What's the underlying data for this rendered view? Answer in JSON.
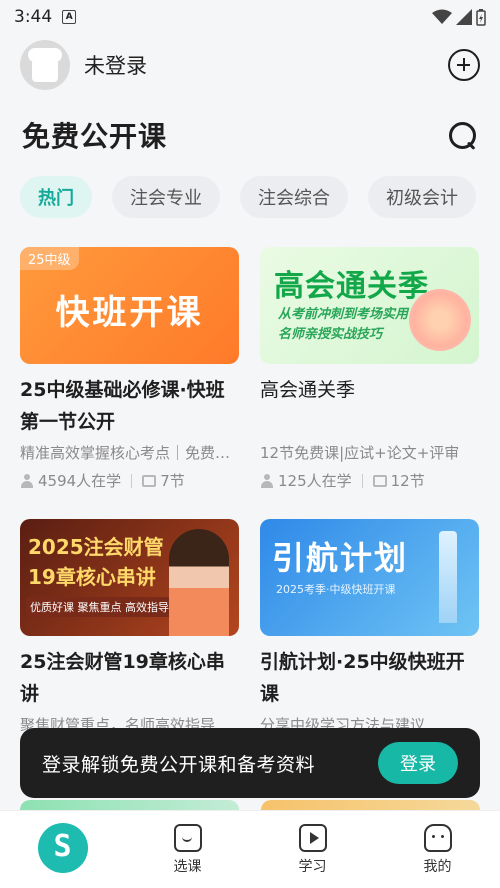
{
  "status_bar": {
    "time": "3:44",
    "notification_glyph": "A"
  },
  "user": {
    "login_label": "未登录"
  },
  "header": {
    "title": "免费公开课"
  },
  "tabs": [
    {
      "label": "热门",
      "active": true
    },
    {
      "label": "注会专业",
      "active": false
    },
    {
      "label": "注会综合",
      "active": false
    },
    {
      "label": "初级会计",
      "active": false
    }
  ],
  "courses": [
    {
      "thumb_badge": "25中级",
      "thumb_text": "快班开课",
      "title": "25中级基础必修课·快班第一节公开",
      "desc": "精准高效掌握核心考点｜免费试听",
      "learners": "4594人在学",
      "lessons": "7节"
    },
    {
      "thumb_text": "高会通关季",
      "thumb_sub1": "从考前冲刺到考场实用",
      "thumb_sub2": "名师亲授实战技巧",
      "title": "高会通关季",
      "desc": "12节免费课|应试+论文+评审",
      "learners": "125人在学",
      "lessons": "12节"
    },
    {
      "thumb_line1": "2025注会财管",
      "thumb_line2": "19章核心串讲",
      "thumb_tags": "优质好课 聚焦重点 高效指导",
      "title": "25注会财管19章核心串讲",
      "desc": "聚焦财管重点，名师高效指导",
      "learners": "",
      "lessons": ""
    },
    {
      "thumb_text": "引航计划",
      "thumb_sub": "2025考季·中级快班开课",
      "title": "引航计划·25中级快班开课",
      "desc": "分享中级学习方法与建议",
      "learners": "",
      "lessons": ""
    }
  ],
  "toast": {
    "text": "登录解锁免费公开课和备考资料",
    "button_label": "登录"
  },
  "tabbar": {
    "items": [
      {
        "label": ""
      },
      {
        "label": "选课"
      },
      {
        "label": "学习"
      },
      {
        "label": "我的"
      }
    ]
  },
  "colors": {
    "accent": "#18b8a6",
    "active_tab_bg": "#dff5f2",
    "toast_bg": "#1f1f1f"
  }
}
